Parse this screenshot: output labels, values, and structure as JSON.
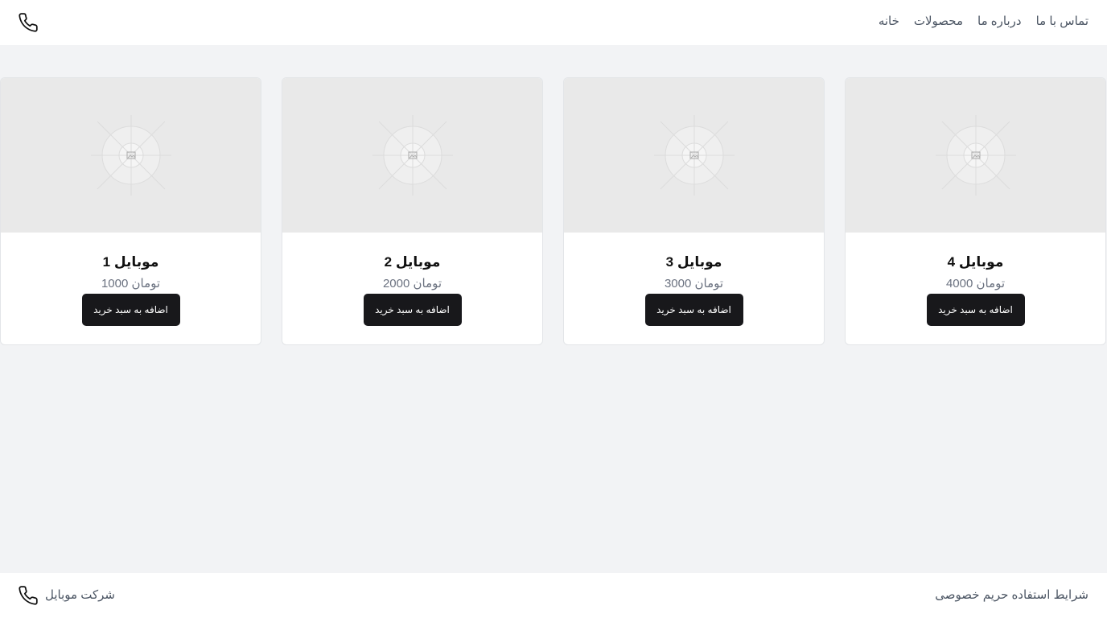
{
  "header": {
    "nav": [
      {
        "label": "خانه"
      },
      {
        "label": "محصولات"
      },
      {
        "label": "درباره ما"
      },
      {
        "label": "تماس با ما"
      }
    ]
  },
  "products": [
    {
      "title": "موبایل 1",
      "price": "تومان 1000",
      "button": "اضافه به سبد خرید"
    },
    {
      "title": "موبایل 2",
      "price": "تومان 2000",
      "button": "اضافه به سبد خرید"
    },
    {
      "title": "موبایل 3",
      "price": "تومان 3000",
      "button": "اضافه به سبد خرید"
    },
    {
      "title": "موبایل 4",
      "price": "تومان 4000",
      "button": "اضافه به سبد خرید"
    }
  ],
  "footer": {
    "company": "شرکت موبایل",
    "links": [
      {
        "label": "حریم خصوصی"
      },
      {
        "label": "شرایط استفاده"
      }
    ]
  },
  "icons": {
    "phone": "phone-icon",
    "image_placeholder": "image-placeholder-icon"
  },
  "colors": {
    "button_bg": "#18181b",
    "page_bg": "#f2f3f5",
    "image_bg": "#e9e9e9",
    "muted_text": "#4b5563"
  }
}
